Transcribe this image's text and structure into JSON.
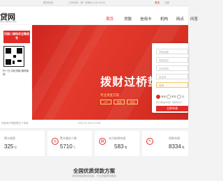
{
  "topbar": {
    "left_text": "服务热线",
    "mid_text": "工作时间：周一至周五 9:00-18:00",
    "login": "登录",
    "register": "注册"
  },
  "header": {
    "logo": "贷网",
    "logo_sub": "www.daikuan.com",
    "nav": [
      "首页",
      "贷款",
      "信用卡",
      "机构",
      "网点",
      "问答"
    ]
  },
  "banner": {
    "flyer_title": "扫描二维码关注微信号",
    "flyer_caption": "扫一扫 手机贷款 随时随地",
    "hero_text": "拨财过桥垫",
    "hero_sub": "专业资金方案",
    "chips": [
      "VIP",
      "快速",
      "低息"
    ]
  },
  "form": {
    "inputs": [
      "贷款金额",
      "您的姓名",
      "手机号码",
      "验证码"
    ],
    "radio_options": [
      "有房",
      "有车",
      "无"
    ],
    "selected_radio": 0,
    "agree": "我已阅读并同意《服务协议》",
    "submit": "立即申请"
  },
  "notice": {
    "text": "贷款用户刚刚提交了申请",
    "time": "2021-07-09 11:07:06"
  },
  "stats": [
    {
      "label": "累计放款",
      "value": "325",
      "unit": "亿"
    },
    {
      "label": "累计服务人数",
      "value": "5710",
      "unit": "人"
    },
    {
      "label": "本月新增申请",
      "value": "583",
      "unit": "笔"
    },
    {
      "label": "贷款申请",
      "value": "8334",
      "unit": "笔"
    }
  ],
  "section": {
    "title": "全国优质贷款方案",
    "subtitle": "多种贷款类型供选择，专业贷款顾问服务"
  }
}
